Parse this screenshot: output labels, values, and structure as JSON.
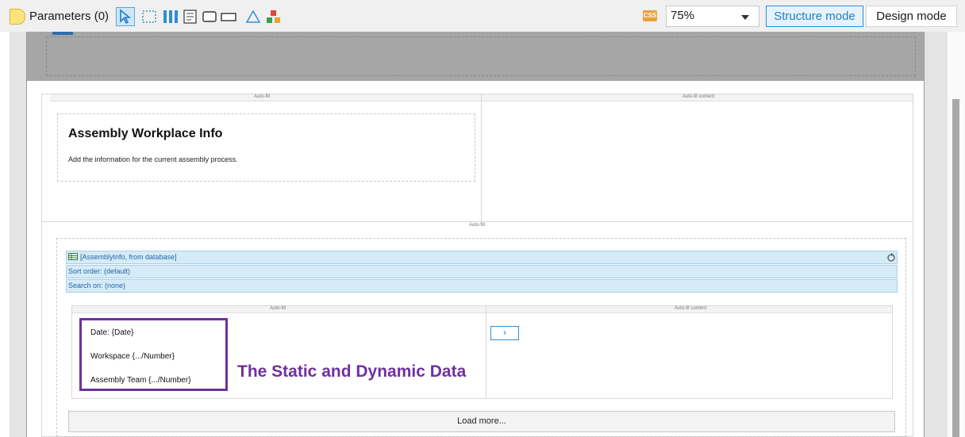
{
  "toolbar": {
    "parameters_label": "Parameters (0)",
    "tool_icons": [
      "pointer-icon",
      "selection-box-icon",
      "columns-icon",
      "form-icon",
      "rectangle-icon",
      "wide-rectangle-icon",
      "shape-icon",
      "components-icon"
    ],
    "css_badge": "CSS",
    "zoom": {
      "value": "75%"
    },
    "modes": {
      "structure": "Structure mode",
      "design": "Design mode",
      "active": "Structure mode"
    }
  },
  "canvas": {
    "top_row": {
      "left_label": "Auto-fill",
      "right_label": "Auto-fit content",
      "heading": "Assembly Workplace Info",
      "subtext": "Add the information for the current assembly process."
    },
    "middle_label": "Auto-fill",
    "data_list": {
      "source": "[AssemblyInfo, from database]",
      "sort_order": "Sort order: (default)",
      "search_on": "Search on: (none)",
      "inner_left_label": "Auto-fill",
      "inner_right_label": "Auto-fit content",
      "fields": [
        "Date: {Date}",
        "Workspace {.../Number}",
        "Assembly Team {.../Number}"
      ],
      "next_button": "›",
      "load_more": "Load more..."
    },
    "annotation": "The Static and Dynamic Data"
  },
  "colors": {
    "accent": "#2f8fd4",
    "annotation": "#7030a0",
    "datasource_row": "#d6ebf8"
  }
}
